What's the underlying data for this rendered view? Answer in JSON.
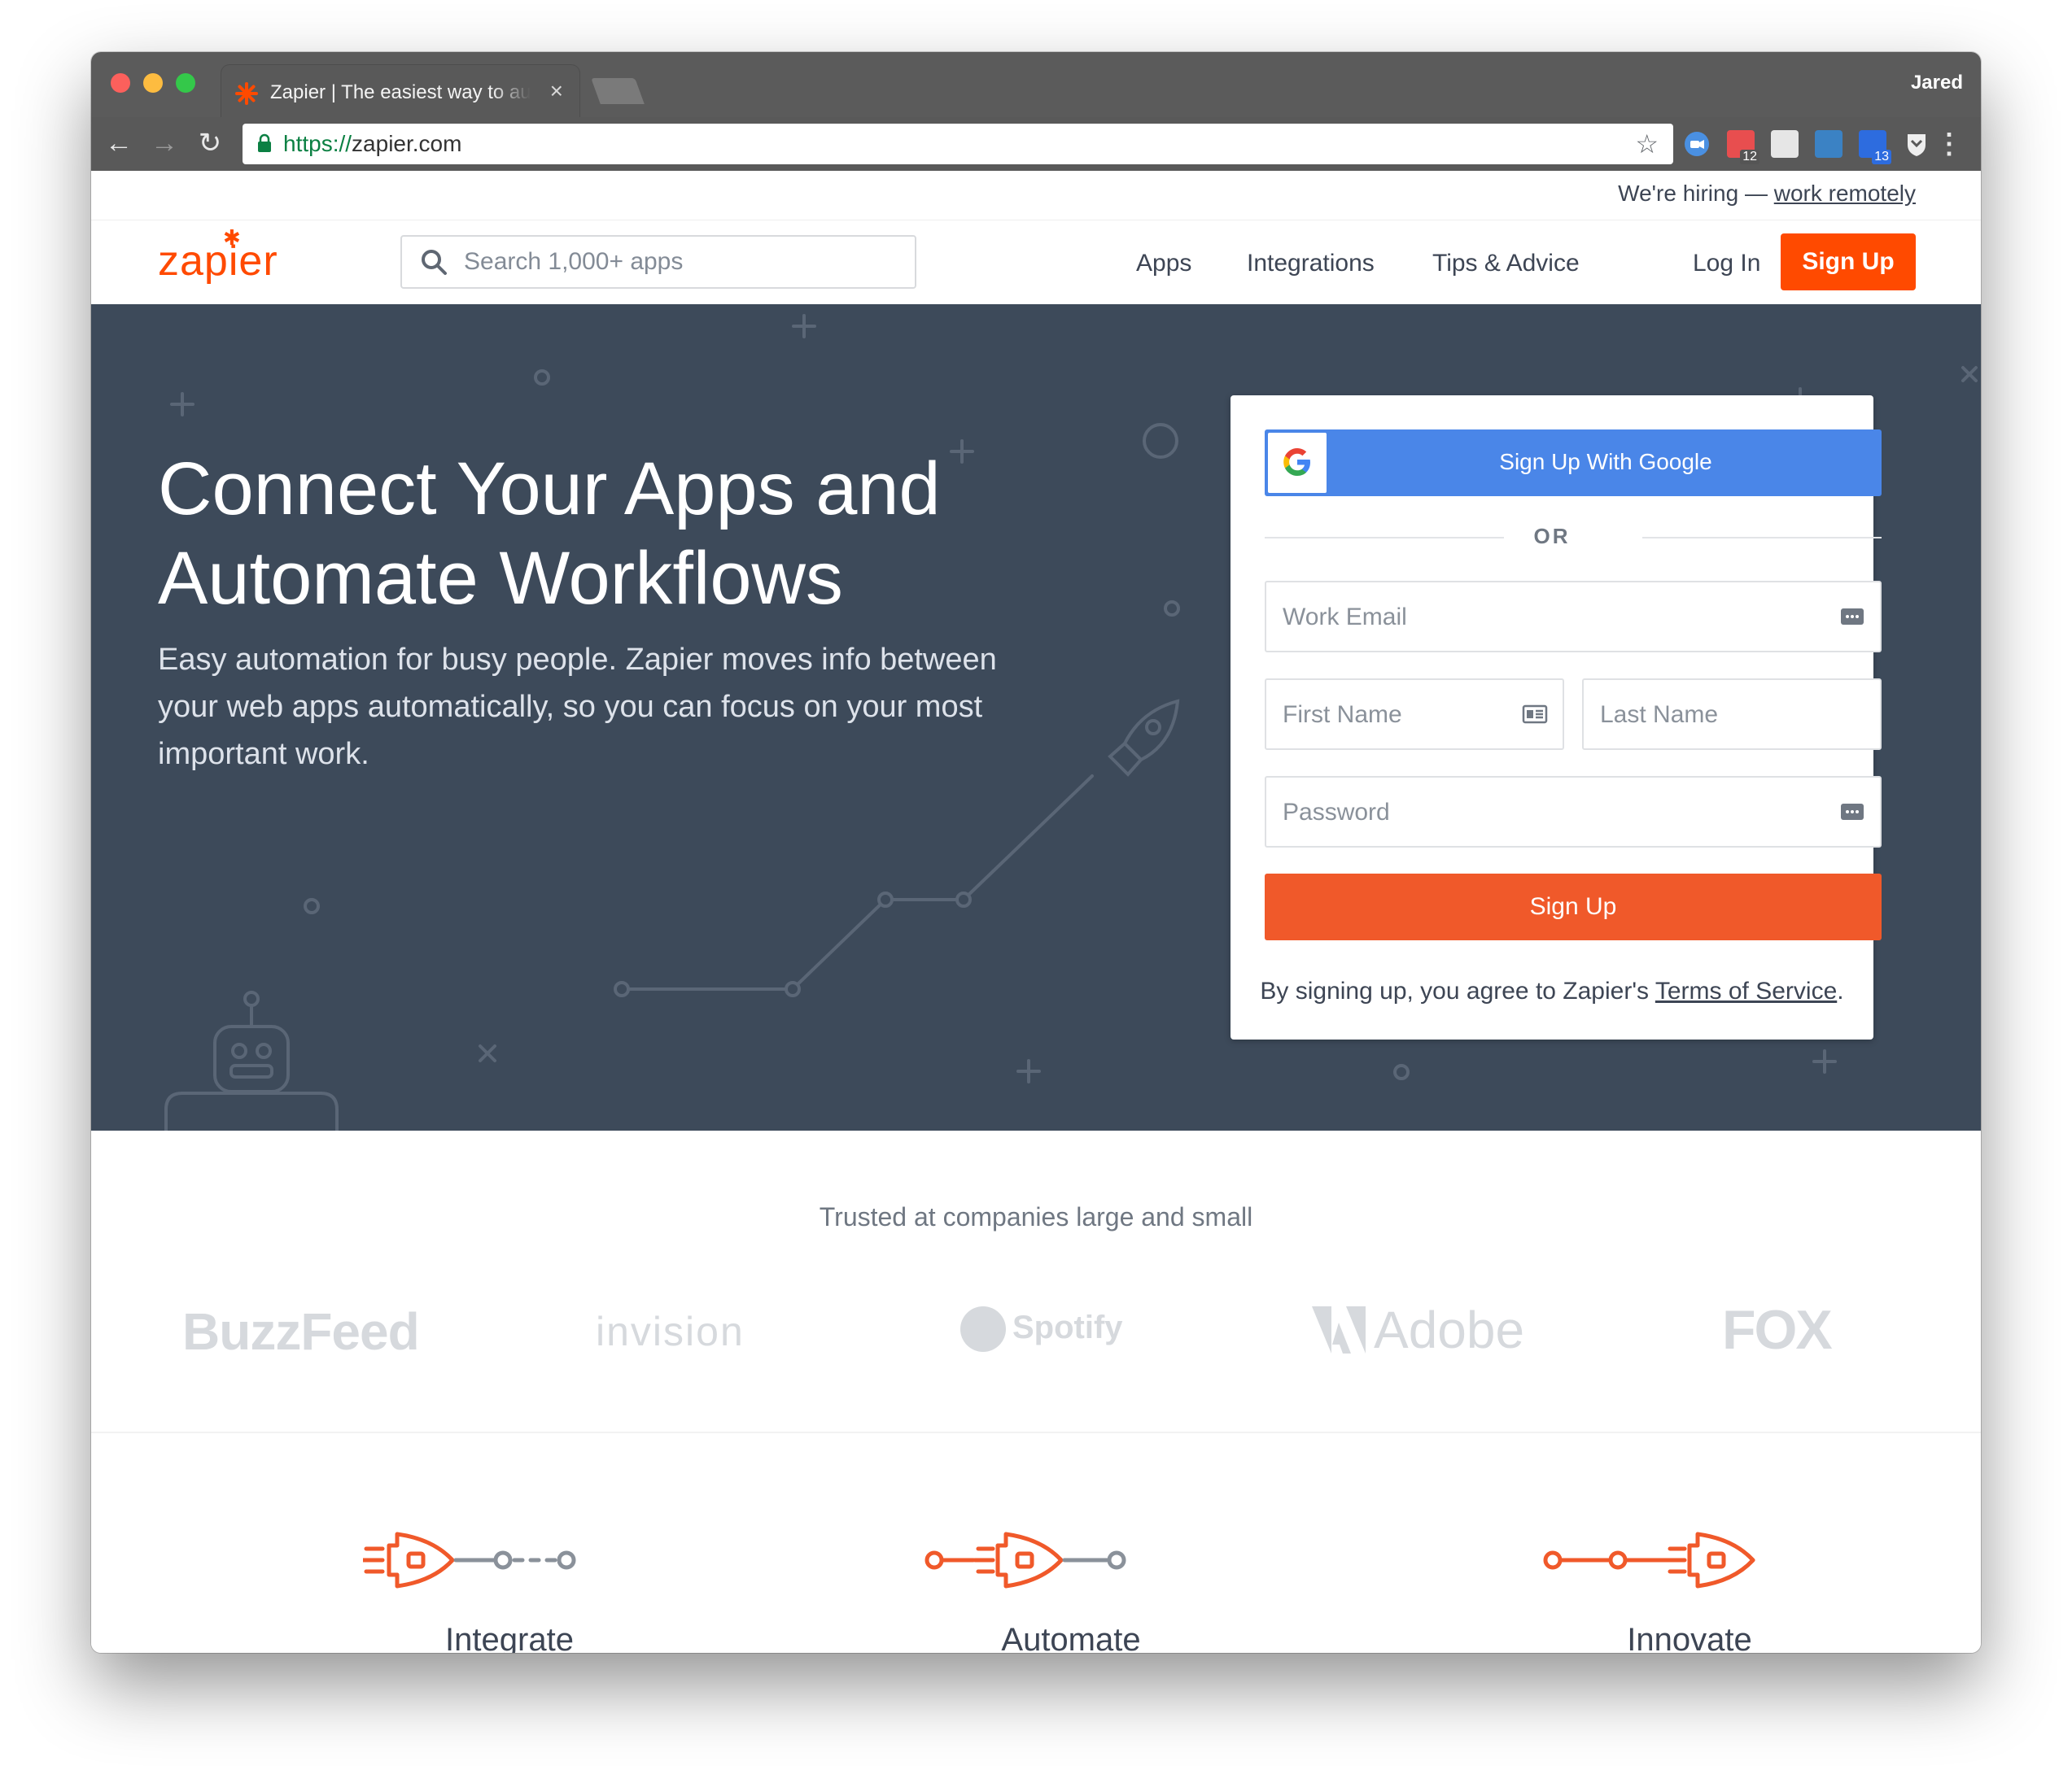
{
  "browser": {
    "tab_title": "Zapier | The easiest way to automate",
    "tab_close": "×",
    "profile_name": "Jared",
    "url_scheme": "https://",
    "url_host": "zapier.com",
    "extensions": [
      {
        "name": "duo",
        "color": "#4a90e2"
      },
      {
        "name": "calendar",
        "badge": "12",
        "color": "#e84e4f"
      },
      {
        "name": "sheet",
        "color": "#dddddd"
      },
      {
        "name": "sk",
        "color": "#3b82c4"
      },
      {
        "name": "todo",
        "badge": "13",
        "color": "#2d6cdf"
      },
      {
        "name": "shield",
        "color": "#eeeeee"
      }
    ]
  },
  "site": {
    "hiring_text": "We're hiring — ",
    "hiring_link": "work remotely",
    "logo_text": "zapier",
    "search_placeholder": "Search 1,000+ apps",
    "nav": [
      "Apps",
      "Integrations",
      "Tips & Advice"
    ],
    "login": "Log In",
    "signup": "Sign Up"
  },
  "hero": {
    "title_line1": "Connect Your Apps and",
    "title_line2": "Automate Workflows",
    "description": "Easy automation for busy people. Zapier moves info between your web apps automatically, so you can focus on your most important work."
  },
  "form": {
    "google_button": "Sign Up With Google",
    "or_text": "OR",
    "email_placeholder": "Work Email",
    "first_name_placeholder": "First Name",
    "last_name_placeholder": "Last Name",
    "password_placeholder": "Password",
    "submit": "Sign Up",
    "terms_prefix": "By signing up, you agree to Zapier's ",
    "terms_link": "Terms of Service",
    "terms_suffix": "."
  },
  "trusted": {
    "heading": "Trusted at companies large and small",
    "brands": [
      "BuzzFeed",
      "invision",
      "Spotify",
      "Adobe",
      "FOX"
    ]
  },
  "features": [
    "Integrate",
    "Automate",
    "Innovate"
  ],
  "colors": {
    "brand_orange": "#ff4a00",
    "hero_bg": "#3d4a5a",
    "google_blue": "#4a86e8"
  }
}
